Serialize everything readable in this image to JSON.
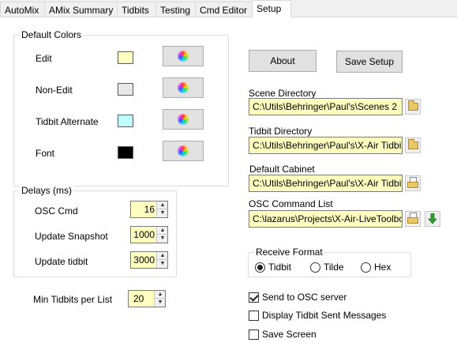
{
  "tabs": [
    "AutoMix",
    "AMix Summary",
    "Tidbits",
    "Testing",
    "Cmd Editor",
    "Setup"
  ],
  "default_colors": {
    "title": "Default Colors",
    "items": [
      {
        "label": "Edit",
        "color": "#ffffc0"
      },
      {
        "label": "Non-Edit",
        "color": "#e8e8e8"
      },
      {
        "label": "Tidbit Alternate",
        "color": "#c0ffff"
      },
      {
        "label": "Font",
        "color": "#000000"
      }
    ]
  },
  "delays": {
    "title": "Delays (ms)",
    "items": [
      {
        "label": "OSC Cmd",
        "value": "16"
      },
      {
        "label": "Update Snapshot",
        "value": "1000"
      },
      {
        "label": "Update tidbit",
        "value": "3000"
      }
    ]
  },
  "min_tidbits": {
    "label": "Min Tidbits per List",
    "value": "20"
  },
  "buttons": {
    "about": "About",
    "save_setup": "Save Setup"
  },
  "directories": {
    "scene": {
      "label": "Scene Directory",
      "value": "C:\\Utils\\Behringer\\Paul's\\Scenes 2"
    },
    "tidbit": {
      "label": "Tidbit Directory",
      "value": "C:\\Utils\\Behringer\\Paul's\\X-Air Tidbits"
    },
    "cabinet": {
      "label": "Default Cabinet",
      "value": "C:\\Utils\\Behringer\\Paul's\\X-Air Tidbits"
    },
    "osc_list": {
      "label": "OSC Command List",
      "value": "C:\\lazarus\\Projects\\X-Air-LiveToolbox"
    }
  },
  "receive_format": {
    "title": "Receive Format",
    "options": [
      "Tidbit",
      "Tilde",
      "Hex"
    ],
    "selected": "Tidbit"
  },
  "checkboxes": [
    {
      "label": "Send to OSC server",
      "checked": true
    },
    {
      "label": "Display Tidbit Sent Messages",
      "checked": false
    },
    {
      "label": "Save Screen",
      "checked": false
    }
  ],
  "icons": {
    "color_picker": "color-wheel-icon",
    "folder": "folder-icon",
    "folder_doc": "folder-document-icon",
    "download": "green-down-arrow-icon"
  },
  "colors": {
    "input_bg": "#ffffc0",
    "accent_green": "#2e9e2e"
  }
}
